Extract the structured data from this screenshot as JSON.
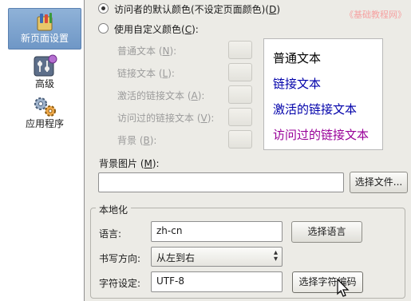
{
  "sidebar": {
    "items": [
      {
        "label": "新页面设置",
        "icon": "new-page-icon",
        "selected": true
      },
      {
        "label": "高级",
        "icon": "advanced-icon",
        "selected": false
      },
      {
        "label": "应用程序",
        "icon": "applications-gear-icon",
        "selected": false
      }
    ]
  },
  "colors": {
    "default_option": {
      "text": "访问者的默认颜色(不设定页面颜色)",
      "key": "D",
      "selected": true
    },
    "custom_option": {
      "text": "使用自定义颜色",
      "key": "C",
      "selected": false
    },
    "rows": [
      {
        "text": "普通文本",
        "key": "N"
      },
      {
        "text": "链接文本",
        "key": "L"
      },
      {
        "text": "激活的链接文本",
        "key": "A"
      },
      {
        "text": "访问过的链接文本",
        "key": "V"
      },
      {
        "text": "背景",
        "key": "B"
      }
    ],
    "preview": [
      {
        "text": "普通文本",
        "color": "#000000"
      },
      {
        "text": "链接文本",
        "color": "#0000aa"
      },
      {
        "text": "激活的链接文本",
        "color": "#0000aa"
      },
      {
        "text": "访问过的链接文本",
        "color": "#990099"
      }
    ]
  },
  "background_image": {
    "label": "背景图片",
    "key": "M",
    "value": "",
    "choose_button": "选择文件..."
  },
  "localization": {
    "title": "本地化",
    "language_label": "语言:",
    "language_value": "zh-cn",
    "language_button": "选择语言",
    "direction_label": "书写方向:",
    "direction_value": "从左到右",
    "charset_label": "字符设定:",
    "charset_value": "UTF-8",
    "charset_button": "选择字符编码"
  },
  "watermark": "《基础教程网》"
}
